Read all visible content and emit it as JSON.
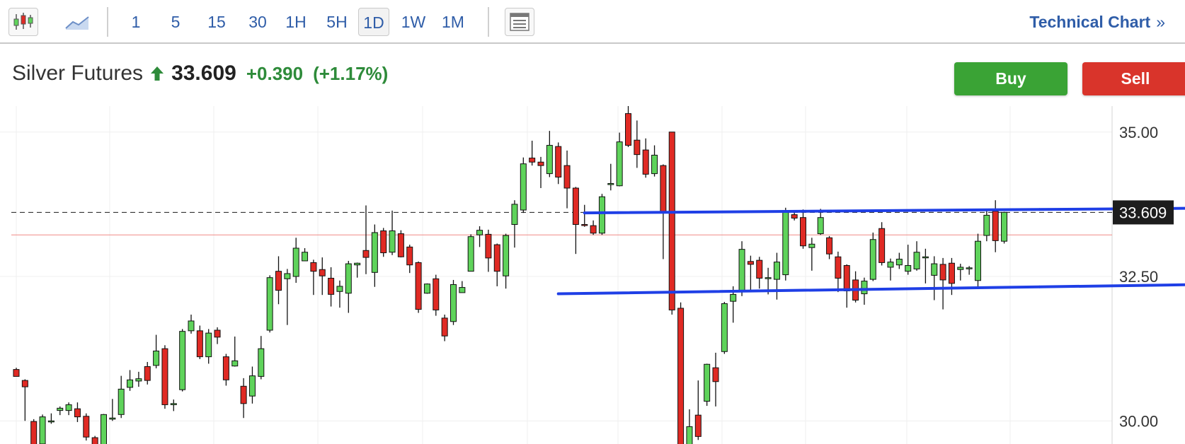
{
  "toolbar": {
    "timeframes": [
      {
        "label": "1"
      },
      {
        "label": "5"
      },
      {
        "label": "15"
      },
      {
        "label": "30"
      },
      {
        "label": "1H"
      },
      {
        "label": "5H"
      },
      {
        "label": "1D",
        "active": true
      },
      {
        "label": "1W"
      },
      {
        "label": "1M"
      }
    ],
    "technical_chart_label": "Technical Chart",
    "technical_chart_chevron": "»",
    "icons": [
      "candlestick-chart-icon",
      "line-chart-icon",
      "layout-icon"
    ]
  },
  "quote": {
    "name": "Silver Futures",
    "price": "33.609",
    "change": "+0.390",
    "change_pct": "(+1.17%)",
    "direction_icon": "up-arrow-icon"
  },
  "actions": {
    "buy_label": "Buy",
    "sell_label": "Sell"
  },
  "colors": {
    "up": "#5fd35b",
    "down": "#e02a24",
    "accent_link": "#2f5da8",
    "trendline": "#1f3fe6",
    "buy": "#3aa335",
    "sell": "#d9342b",
    "change_positive": "#2e8b3a"
  },
  "chart_data": {
    "type": "candlestick",
    "ylim": [
      29.6,
      35.45
    ],
    "y_ticks": [
      {
        "value": 35.0,
        "label": "35.00"
      },
      {
        "value": 32.5,
        "label": "32.50"
      },
      {
        "value": 30.0,
        "label": "30.00"
      }
    ],
    "last_price": 33.609,
    "last_price_label": "33.609",
    "prev_close": 33.219,
    "grid": true,
    "candles": [
      [
        30.89,
        30.77,
        30.92,
        30.77
      ],
      [
        30.7,
        30.59,
        30.72,
        30.0
      ],
      [
        29.99,
        29.58,
        30.03,
        29.53
      ],
      [
        29.6,
        30.07,
        30.11,
        29.59
      ],
      [
        30.0,
        30.0,
        30.13,
        29.95
      ],
      [
        30.18,
        30.22,
        30.25,
        30.1
      ],
      [
        30.18,
        30.28,
        30.32,
        30.1
      ],
      [
        30.21,
        30.07,
        30.32,
        29.98
      ],
      [
        30.08,
        29.72,
        30.13,
        29.66
      ],
      [
        29.71,
        29.56,
        29.74,
        29.54
      ],
      [
        29.59,
        30.11,
        30.12,
        29.58
      ],
      [
        30.03,
        30.05,
        30.38,
        30.0
      ],
      [
        30.11,
        30.55,
        30.78,
        30.05
      ],
      [
        30.58,
        30.71,
        30.88,
        30.52
      ],
      [
        30.69,
        30.73,
        30.85,
        30.59
      ],
      [
        30.94,
        30.7,
        31.02,
        30.63
      ],
      [
        30.96,
        31.21,
        31.49,
        30.91
      ],
      [
        31.25,
        30.28,
        31.31,
        30.21
      ],
      [
        30.28,
        30.3,
        30.37,
        30.17
      ],
      [
        30.54,
        31.55,
        31.59,
        30.51
      ],
      [
        31.56,
        31.73,
        31.84,
        31.51
      ],
      [
        31.56,
        31.11,
        31.65,
        31.07
      ],
      [
        31.11,
        31.52,
        31.59,
        30.99
      ],
      [
        31.57,
        31.45,
        31.62,
        31.33
      ],
      [
        31.11,
        30.71,
        31.16,
        30.61
      ],
      [
        30.95,
        31.04,
        31.46,
        30.94
      ],
      [
        30.6,
        30.3,
        30.74,
        30.05
      ],
      [
        30.43,
        30.78,
        30.94,
        30.3
      ],
      [
        30.77,
        31.25,
        31.47,
        30.72
      ],
      [
        31.57,
        32.48,
        32.52,
        31.53
      ],
      [
        32.59,
        32.26,
        32.85,
        32.02
      ],
      [
        32.46,
        32.55,
        32.63,
        31.66
      ],
      [
        32.5,
        32.99,
        33.17,
        32.39
      ],
      [
        32.77,
        32.92,
        32.99,
        32.82
      ],
      [
        32.74,
        32.59,
        32.79,
        32.18
      ],
      [
        32.62,
        32.51,
        32.83,
        32.18
      ],
      [
        32.47,
        32.19,
        32.66,
        31.98
      ],
      [
        32.24,
        32.33,
        32.43,
        31.96
      ],
      [
        32.21,
        32.72,
        32.77,
        31.87
      ],
      [
        32.7,
        32.73,
        32.74,
        32.48
      ],
      [
        32.95,
        32.83,
        33.73,
        32.54
      ],
      [
        32.57,
        33.26,
        33.4,
        32.32
      ],
      [
        33.29,
        32.91,
        33.34,
        32.84
      ],
      [
        32.92,
        33.29,
        33.64,
        32.87
      ],
      [
        33.24,
        32.84,
        33.3,
        32.83
      ],
      [
        33.01,
        32.7,
        33.05,
        32.56
      ],
      [
        32.74,
        31.93,
        32.76,
        31.87
      ],
      [
        32.21,
        32.37,
        32.38,
        32.2
      ],
      [
        32.46,
        31.92,
        32.53,
        31.82
      ],
      [
        31.78,
        31.47,
        31.84,
        31.38
      ],
      [
        31.72,
        32.36,
        32.44,
        31.66
      ],
      [
        32.22,
        32.31,
        32.42,
        32.22
      ],
      [
        32.59,
        33.19,
        33.23,
        32.59
      ],
      [
        33.22,
        33.3,
        33.37,
        33.01
      ],
      [
        33.23,
        32.82,
        33.31,
        32.58
      ],
      [
        33.05,
        32.59,
        33.07,
        32.33
      ],
      [
        32.51,
        33.21,
        33.24,
        32.29
      ],
      [
        33.4,
        33.75,
        33.82,
        33.0
      ],
      [
        33.65,
        34.45,
        34.56,
        33.6
      ],
      [
        34.55,
        34.48,
        34.85,
        34.42
      ],
      [
        34.48,
        34.42,
        34.57,
        34.03
      ],
      [
        34.28,
        34.77,
        35.02,
        34.22
      ],
      [
        34.75,
        34.22,
        34.82,
        34.1
      ],
      [
        34.42,
        34.03,
        34.68,
        33.68
      ],
      [
        34.03,
        33.4,
        34.05,
        32.89
      ],
      [
        33.4,
        33.39,
        33.74,
        33.36
      ],
      [
        33.38,
        33.25,
        33.47,
        33.22
      ],
      [
        33.25,
        33.88,
        33.93,
        33.22
      ],
      [
        34.09,
        34.11,
        34.45,
        33.99
      ],
      [
        34.07,
        34.83,
        34.99,
        34.06
      ],
      [
        35.32,
        34.77,
        35.52,
        34.74
      ],
      [
        34.86,
        34.61,
        35.2,
        34.38
      ],
      [
        34.69,
        34.27,
        34.89,
        34.21
      ],
      [
        34.28,
        34.6,
        34.77,
        34.23
      ],
      [
        34.42,
        33.6,
        34.44,
        32.8
      ],
      [
        35.0,
        31.92,
        35.0,
        31.84
      ],
      [
        31.95,
        29.55,
        32.05,
        29.55
      ],
      [
        29.55,
        29.9,
        30.2,
        29.3
      ],
      [
        30.1,
        29.73,
        30.7,
        29.67
      ],
      [
        30.34,
        30.98,
        30.99,
        30.26
      ],
      [
        30.92,
        30.68,
        31.18,
        30.25
      ],
      [
        31.2,
        32.03,
        32.06,
        31.16
      ],
      [
        32.07,
        32.19,
        32.33,
        31.7
      ],
      [
        32.24,
        32.97,
        33.11,
        32.16
      ],
      [
        32.76,
        32.71,
        32.86,
        32.26
      ],
      [
        32.78,
        32.47,
        32.84,
        32.29
      ],
      [
        32.48,
        32.48,
        32.65,
        32.19
      ],
      [
        32.45,
        32.75,
        32.91,
        32.1
      ],
      [
        32.53,
        33.64,
        33.69,
        32.43
      ],
      [
        33.57,
        33.51,
        33.65,
        33.47
      ],
      [
        33.52,
        33.03,
        33.66,
        32.98
      ],
      [
        33.0,
        33.06,
        33.17,
        32.6
      ],
      [
        33.24,
        33.52,
        33.67,
        33.22
      ],
      [
        33.17,
        32.89,
        33.2,
        32.8
      ],
      [
        32.84,
        32.47,
        32.93,
        32.23
      ],
      [
        32.69,
        32.25,
        32.71,
        31.96
      ],
      [
        32.44,
        32.09,
        32.59,
        32.05
      ],
      [
        32.2,
        32.42,
        32.48,
        32.01
      ],
      [
        32.45,
        33.14,
        33.26,
        32.42
      ],
      [
        33.33,
        32.74,
        33.44,
        32.69
      ],
      [
        32.66,
        32.75,
        32.81,
        32.43
      ],
      [
        32.7,
        32.8,
        32.91,
        32.63
      ],
      [
        32.59,
        32.69,
        33.05,
        32.53
      ],
      [
        32.63,
        32.92,
        33.11,
        32.6
      ],
      [
        32.84,
        32.84,
        32.98,
        32.38
      ],
      [
        32.52,
        32.72,
        32.85,
        32.09
      ],
      [
        32.71,
        32.44,
        32.82,
        31.93
      ],
      [
        32.73,
        32.38,
        32.82,
        32.18
      ],
      [
        32.62,
        32.66,
        32.72,
        32.43
      ],
      [
        32.64,
        32.65,
        32.68,
        32.53
      ],
      [
        32.43,
        33.11,
        33.24,
        32.28
      ],
      [
        33.21,
        33.56,
        33.67,
        33.11
      ],
      [
        33.63,
        33.12,
        33.82,
        32.92
      ],
      [
        33.11,
        33.61,
        33.62,
        33.07
      ]
    ],
    "trendlines": [
      {
        "from_index": 65,
        "from_price": 33.6,
        "to_index": 117,
        "to_price": 33.66
      },
      {
        "from_index": 62,
        "from_price": 32.2,
        "to_index": 117,
        "to_price": 32.32
      }
    ]
  }
}
